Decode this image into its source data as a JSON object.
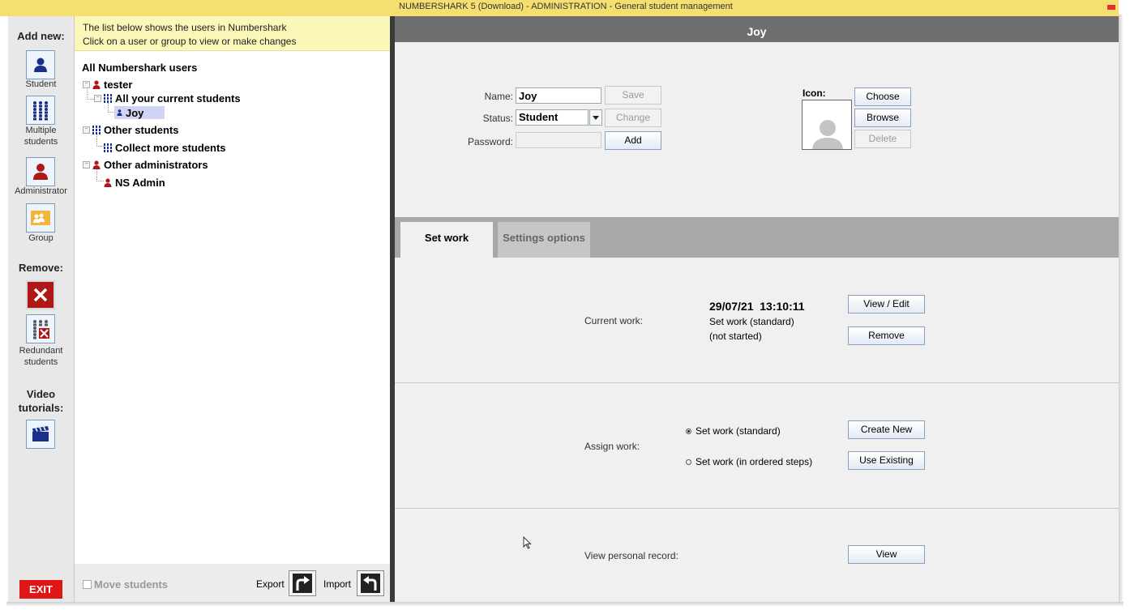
{
  "window": {
    "title": "NUMBERSHARK 5 (Download)   -   ADMINISTRATION - General student management"
  },
  "toolbar": {
    "add_new_heading": "Add new:",
    "add_items": [
      {
        "label": "Student",
        "icon": "student-icon"
      },
      {
        "label": "Multiple students",
        "icon": "multiple-students-icon"
      },
      {
        "label": "Administrator",
        "icon": "administrator-icon"
      },
      {
        "label": "Group",
        "icon": "group-icon"
      }
    ],
    "remove_heading": "Remove:",
    "remove_items": [
      {
        "label": "",
        "icon": "remove-icon"
      },
      {
        "label": "Redundant students",
        "icon": "redundant-students-icon"
      }
    ],
    "video_heading": "Video tutorials:",
    "video_icon": "clapperboard-icon",
    "exit_label": "EXIT"
  },
  "tree": {
    "header_line1": "The list below shows the users in Numbershark",
    "header_line2": "Click on a user or group to view or make changes",
    "root_label": "All Numbershark users",
    "nodes": {
      "tester": "tester",
      "current_students": "All your current students",
      "joy": "Joy",
      "other_students": "Other students",
      "collect_more": "Collect more students",
      "other_admins": "Other administrators",
      "ns_admin": "NS Admin"
    },
    "footer": {
      "move_students": "Move students",
      "move_students_checked": false,
      "export_label": "Export",
      "import_label": "Import"
    }
  },
  "user": {
    "header_name": "Joy",
    "name_label": "Name:",
    "name_value": "Joy",
    "status_label": "Status:",
    "status_value": "Student",
    "password_label": "Password:",
    "password_value": "",
    "save_label": "Save",
    "change_label": "Change",
    "add_label": "Add",
    "icon_label": "Icon:",
    "choose_label": "Choose",
    "browse_label": "Browse",
    "delete_label": "Delete"
  },
  "tabs": [
    {
      "label": "Set work",
      "active": true
    },
    {
      "label": "Settings options",
      "active": false
    }
  ],
  "setwork": {
    "current_work_label": "Current work:",
    "current_date": "29/07/21  13:10:11",
    "current_type": "Set work (standard)",
    "current_state": "(not started)",
    "view_edit_label": "View / Edit",
    "remove_label": "Remove",
    "assign_work_label": "Assign work:",
    "options": [
      {
        "label": "Set work (standard)",
        "selected": true
      },
      {
        "label": "Set work (in ordered steps)",
        "selected": false
      }
    ],
    "create_new_label": "Create New",
    "use_existing_label": "Use Existing",
    "personal_record_label": "View personal record:",
    "view_label": "View"
  },
  "colors": {
    "title_bar": "#f5df70",
    "tree_header": "#fbf7b8",
    "selected_node": "#cfd4f5",
    "main_header": "#6e6e6e",
    "exit": "#e01515"
  }
}
